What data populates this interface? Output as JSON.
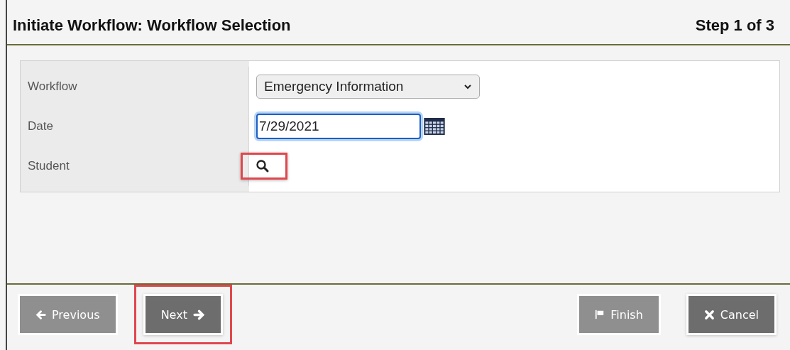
{
  "header": {
    "title": "Initiate Workflow: Workflow Selection",
    "step": "Step 1 of 3"
  },
  "form": {
    "rows": [
      {
        "kind": "select",
        "label": "Workflow",
        "value": "Emergency Information"
      },
      {
        "kind": "date",
        "label": "Date",
        "value": "7/29/2021",
        "focused": true
      },
      {
        "kind": "lookup",
        "label": "Student",
        "highlighted": true
      }
    ]
  },
  "footer": {
    "left": [
      {
        "kind": "previous",
        "label": "Previous",
        "disabled": true,
        "highlighted": false
      },
      {
        "kind": "next",
        "label": "Next",
        "disabled": false,
        "highlighted": true
      }
    ],
    "right": [
      {
        "kind": "finish",
        "label": "Finish",
        "disabled": true,
        "highlighted": false
      },
      {
        "kind": "cancel",
        "label": "Cancel",
        "disabled": false,
        "highlighted": false
      }
    ]
  }
}
